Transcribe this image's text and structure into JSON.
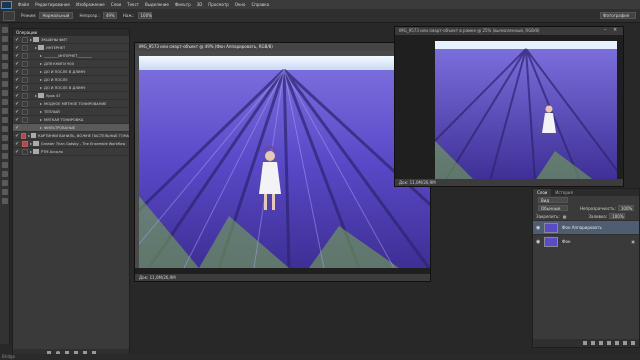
{
  "menu": {
    "items": [
      "Файл",
      "Редактирование",
      "Изображение",
      "Слои",
      "Текст",
      "Выделение",
      "Фильтр",
      "3D",
      "Просмотр",
      "Окно",
      "Справка"
    ]
  },
  "options": {
    "mode_label": "Режим:",
    "mode_value": "Нормальный",
    "opacity_label": "Непрозр.:",
    "opacity_value": "49%",
    "pressure_label": "Наж.:",
    "pressure_value": "100%",
    "workspace_value": "Фотография"
  },
  "actions": {
    "title": "Операции",
    "rows": [
      {
        "label": "ЭКШЕНЫ ФИТ",
        "checked": true,
        "dialog": "none",
        "folder": true,
        "indent": 0
      },
      {
        "label": "ИНТЕРНЕТ",
        "checked": true,
        "dialog": "none",
        "folder": true,
        "indent": 1
      },
      {
        "label": "________ИНТЕРНЕТ________",
        "checked": true,
        "dialog": "none",
        "folder": false,
        "indent": 2
      },
      {
        "label": "ДЛЯ КНИГИ 900",
        "checked": true,
        "dialog": "none",
        "folder": false,
        "indent": 2
      },
      {
        "label": "ДО И ПОСЛЕ В ДЛИНУ",
        "checked": true,
        "dialog": "none",
        "folder": false,
        "indent": 2
      },
      {
        "label": "ДО И ПОСЛЕ",
        "checked": true,
        "dialog": "none",
        "folder": false,
        "indent": 2
      },
      {
        "label": "ДО И ПОСЛЕ В ДЛИНУ",
        "checked": true,
        "dialog": "none",
        "folder": false,
        "indent": 2
      },
      {
        "label": "Урок 47",
        "checked": true,
        "dialog": "none",
        "folder": true,
        "indent": 1
      },
      {
        "label": "МОДНОЕ МЯТНОЕ ТОНИРОВАНИЕ",
        "checked": true,
        "dialog": "none",
        "folder": false,
        "indent": 2
      },
      {
        "label": "ТЕПЛЫЙ",
        "checked": true,
        "dialog": "none",
        "folder": false,
        "indent": 2
      },
      {
        "label": "МЯГКАЯ ТОНИРОВКА",
        "checked": true,
        "dialog": "none",
        "folder": false,
        "indent": 2
      },
      {
        "label": "ФИЛЬТРОВАНЫЕ",
        "checked": true,
        "dialog": "none",
        "folder": false,
        "indent": 2,
        "selected": true
      },
      {
        "label": "КАРТИНКИ ВАНИЛЬ, ВОЖНЕ ПАСТЕЛЬНЫЕ ТОНА",
        "checked": true,
        "dialog": "red",
        "folder": true,
        "indent": 0
      },
      {
        "label": "Greater Than Gatsby - The Ensemble Workflow",
        "checked": true,
        "dialog": "red",
        "folder": true,
        "indent": 0
      },
      {
        "label": "PTM Ассоля",
        "checked": true,
        "dialog": "none",
        "folder": true,
        "indent": 0
      }
    ]
  },
  "doc_main": {
    "title": "IMG_9573 или смарт-объект @ 49% (Фон Аппарировать, RGB/8)",
    "status": "Док: 11,0M/26,9M"
  },
  "doc_second": {
    "title": "IMG_9573 или смарт-объект в рамке @ 25% (вычисленный, RGB/8)",
    "status": "Док: 11,0M/26,9M"
  },
  "layers": {
    "tabs": [
      "Слои",
      "История"
    ],
    "kind_label": "Вид",
    "blend_value": "Обычные",
    "opacity_label": "Непрозрачность:",
    "opacity_value": "100%",
    "lock_label": "Закрепить:",
    "fill_label": "Заливка:",
    "fill_value": "100%",
    "items": [
      {
        "name": "Фон Аппарировать",
        "selected": true
      },
      {
        "name": "Фон",
        "selected": false
      }
    ]
  },
  "bottom": {
    "text": "Bridge"
  },
  "colors": {
    "lavender": "#5c4fd6",
    "sky": "#dff0ff",
    "grass": "#6fa83a",
    "accent_selection": "#4f5d73"
  }
}
